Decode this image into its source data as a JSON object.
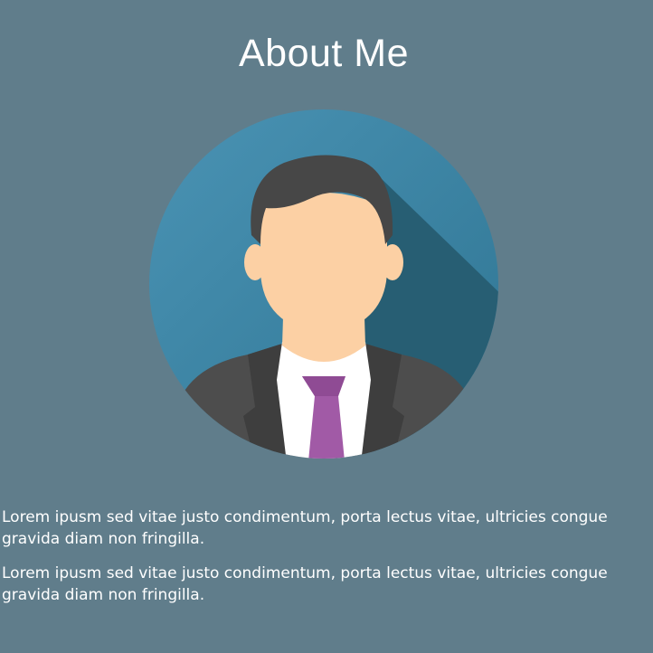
{
  "page": {
    "title": "About Me",
    "background": "#607d8b"
  },
  "avatar": {
    "icon": "businessman-avatar-icon",
    "circle_color": "#3f87a6",
    "shadow_color": "#2a6378",
    "hair_color": "#474747",
    "skin_color": "#fcd0a4",
    "suit_color": "#4d4d4d",
    "tie_color": "#a15aa6"
  },
  "bio": {
    "paragraphs": [
      "Lorem ipusm sed vitae justo condimentum, porta lectus vitae, ultricies congue gravida diam non fringilla.",
      "Lorem ipusm sed vitae justo condimentum, porta lectus vitae, ultricies congue gravida diam non fringilla."
    ]
  }
}
